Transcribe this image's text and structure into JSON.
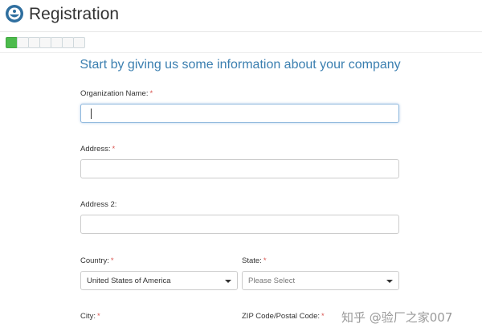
{
  "header": {
    "title": "Registration",
    "logo_icon": "bowl-hands-logo-icon"
  },
  "progress": {
    "total_steps": 7,
    "completed_steps": 1,
    "done_color": "#4cbb4c"
  },
  "form": {
    "heading": "Start by giving us some information about your company",
    "required_marker": "*",
    "organization_name": {
      "label": "Organization Name:",
      "value": ""
    },
    "address": {
      "label": "Address:",
      "value": ""
    },
    "address2": {
      "label": "Address 2:",
      "value": ""
    },
    "country": {
      "label": "Country:",
      "selected": "United States of America"
    },
    "state": {
      "label": "State:",
      "placeholder": "Please Select"
    },
    "city": {
      "label": "City:"
    },
    "zip": {
      "label": "ZIP Code/Postal Code:"
    }
  },
  "watermark": "知乎 @验厂之家007",
  "colors": {
    "heading": "#3b7fb0",
    "required": "#d9534f",
    "focus_border": "#8fb8dd"
  }
}
